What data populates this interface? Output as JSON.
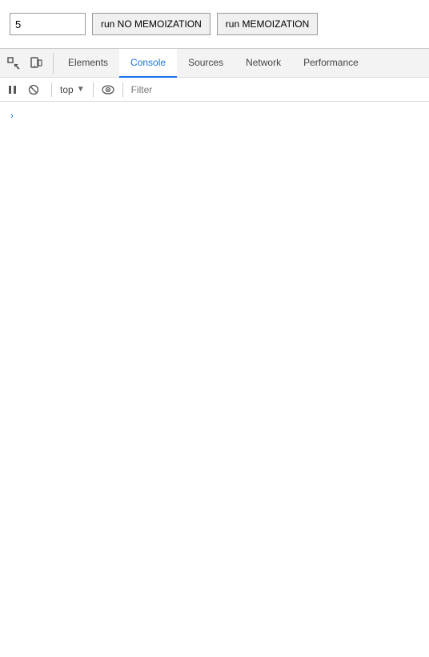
{
  "page": {
    "input_value": "5",
    "btn_no_memo": "run NO MEMOIZATION",
    "btn_memo": "run MEMOIZATION"
  },
  "devtools": {
    "tabs": [
      {
        "id": "elements",
        "label": "Elements",
        "active": false
      },
      {
        "id": "console",
        "label": "Console",
        "active": true
      },
      {
        "id": "sources",
        "label": "Sources",
        "active": false
      },
      {
        "id": "network",
        "label": "Network",
        "active": false
      },
      {
        "id": "performance",
        "label": "Performance",
        "active": false
      }
    ],
    "console": {
      "context": "top",
      "filter_placeholder": "Filter"
    }
  }
}
